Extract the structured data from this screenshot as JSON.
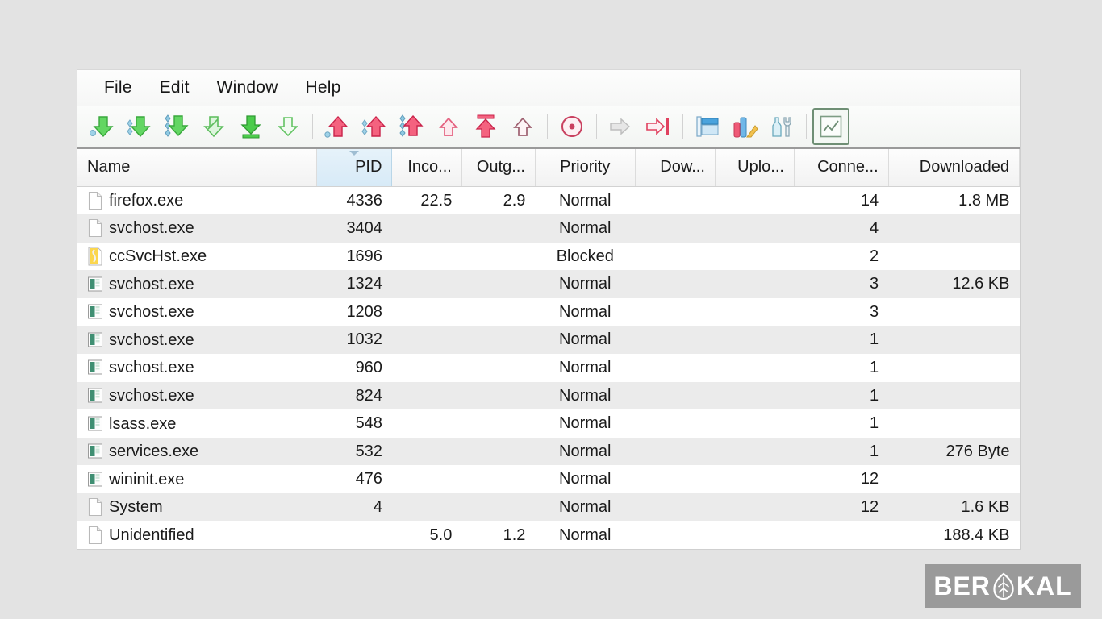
{
  "window": {
    "menu": [
      {
        "label": "File",
        "name": "menu-file"
      },
      {
        "label": "Edit",
        "name": "menu-edit"
      },
      {
        "label": "Window",
        "name": "menu-window"
      },
      {
        "label": "Help",
        "name": "menu-help"
      }
    ],
    "toolbar": [
      {
        "name": "download-start-button",
        "icon": "arrow-down-green-dot",
        "group": 0
      },
      {
        "name": "download-resume-button",
        "icon": "arrow-down-green-links",
        "group": 0
      },
      {
        "name": "download-all-button",
        "icon": "arrow-down-green-double",
        "group": 0
      },
      {
        "name": "download-pause-button",
        "icon": "arrow-down-green-outline",
        "group": 0
      },
      {
        "name": "download-limit-button",
        "icon": "arrow-down-green-bar",
        "group": 0
      },
      {
        "name": "download-stop-button",
        "icon": "arrow-down-green-hollow",
        "group": 0
      },
      {
        "name": "upload-start-button",
        "icon": "arrow-up-red-dot",
        "group": 1
      },
      {
        "name": "upload-resume-button",
        "icon": "arrow-up-red-links",
        "group": 1
      },
      {
        "name": "upload-all-button",
        "icon": "arrow-up-red-double",
        "group": 1
      },
      {
        "name": "upload-pause-button",
        "icon": "arrow-up-red-outline",
        "group": 1
      },
      {
        "name": "upload-limit-button",
        "icon": "arrow-up-red-bar",
        "group": 1
      },
      {
        "name": "upload-stop-button",
        "icon": "arrow-up-red-hollow",
        "group": 1
      },
      {
        "name": "record-button",
        "icon": "record-circle",
        "group": 2
      },
      {
        "name": "forward-traffic-button",
        "icon": "arrow-right-grey",
        "group": 3
      },
      {
        "name": "block-traffic-button",
        "icon": "arrow-right-red-block",
        "group": 3
      },
      {
        "name": "window-layout-button",
        "icon": "window-blue",
        "group": 4
      },
      {
        "name": "statistics-button",
        "icon": "bar-chart-color",
        "group": 4
      },
      {
        "name": "settings-button",
        "icon": "bottle-wrench",
        "group": 4
      },
      {
        "name": "graph-view-button",
        "icon": "graph-framed",
        "group": 5,
        "active": true
      }
    ],
    "table": {
      "columns": [
        {
          "label": "Name",
          "name": "column-name",
          "align": "left",
          "width": "25.4%",
          "sorted": false
        },
        {
          "label": "PID",
          "name": "column-pid",
          "align": "right",
          "width": "8.0%",
          "sorted": true
        },
        {
          "label": "Inco...",
          "name": "column-incoming",
          "align": "right",
          "width": "7.4%",
          "sorted": false
        },
        {
          "label": "Outg...",
          "name": "column-outgoing",
          "align": "right",
          "width": "7.8%",
          "sorted": false
        },
        {
          "label": "Priority",
          "name": "column-priority",
          "align": "center",
          "width": "10.6%",
          "sorted": false
        },
        {
          "label": "Dow...",
          "name": "column-download",
          "align": "right",
          "width": "8.5%",
          "sorted": false
        },
        {
          "label": "Uplo...",
          "name": "column-upload",
          "align": "right",
          "width": "8.4%",
          "sorted": false
        },
        {
          "label": "Conne...",
          "name": "column-connections",
          "align": "right",
          "width": "10.0%",
          "sorted": false
        },
        {
          "label": "Downloaded",
          "name": "column-downloaded",
          "align": "right",
          "width": "13.9%",
          "sorted": false
        }
      ],
      "rows": [
        {
          "icon": "file-blank",
          "name": "firefox.exe",
          "pid": "4336",
          "incoming": "22.5",
          "outgoing": "2.9",
          "priority": "Normal",
          "download": "",
          "upload": "",
          "connections": "14",
          "downloaded": "1.8 MB"
        },
        {
          "icon": "file-blank",
          "name": "svchost.exe",
          "pid": "3404",
          "incoming": "",
          "outgoing": "",
          "priority": "Normal",
          "download": "",
          "upload": "",
          "connections": "4",
          "downloaded": ""
        },
        {
          "icon": "file-yellow",
          "name": "ccSvcHst.exe",
          "pid": "1696",
          "incoming": "",
          "outgoing": "",
          "priority": "Blocked",
          "download": "",
          "upload": "",
          "connections": "2",
          "downloaded": ""
        },
        {
          "icon": "service-green",
          "name": "svchost.exe",
          "pid": "1324",
          "incoming": "",
          "outgoing": "",
          "priority": "Normal",
          "download": "",
          "upload": "",
          "connections": "3",
          "downloaded": "12.6 KB"
        },
        {
          "icon": "service-green",
          "name": "svchost.exe",
          "pid": "1208",
          "incoming": "",
          "outgoing": "",
          "priority": "Normal",
          "download": "",
          "upload": "",
          "connections": "3",
          "downloaded": ""
        },
        {
          "icon": "service-green",
          "name": "svchost.exe",
          "pid": "1032",
          "incoming": "",
          "outgoing": "",
          "priority": "Normal",
          "download": "",
          "upload": "",
          "connections": "1",
          "downloaded": ""
        },
        {
          "icon": "service-green",
          "name": "svchost.exe",
          "pid": "960",
          "incoming": "",
          "outgoing": "",
          "priority": "Normal",
          "download": "",
          "upload": "",
          "connections": "1",
          "downloaded": ""
        },
        {
          "icon": "service-green",
          "name": "svchost.exe",
          "pid": "824",
          "incoming": "",
          "outgoing": "",
          "priority": "Normal",
          "download": "",
          "upload": "",
          "connections": "1",
          "downloaded": ""
        },
        {
          "icon": "service-green",
          "name": "lsass.exe",
          "pid": "548",
          "incoming": "",
          "outgoing": "",
          "priority": "Normal",
          "download": "",
          "upload": "",
          "connections": "1",
          "downloaded": ""
        },
        {
          "icon": "service-green",
          "name": "services.exe",
          "pid": "532",
          "incoming": "",
          "outgoing": "",
          "priority": "Normal",
          "download": "",
          "upload": "",
          "connections": "1",
          "downloaded": "276 Byte"
        },
        {
          "icon": "service-green",
          "name": "wininit.exe",
          "pid": "476",
          "incoming": "",
          "outgoing": "",
          "priority": "Normal",
          "download": "",
          "upload": "",
          "connections": "12",
          "downloaded": ""
        },
        {
          "icon": "file-blank",
          "name": "System",
          "pid": "4",
          "incoming": "",
          "outgoing": "",
          "priority": "Normal",
          "download": "",
          "upload": "",
          "connections": "12",
          "downloaded": "1.6 KB"
        },
        {
          "icon": "file-blank",
          "name": "Unidentified",
          "pid": "",
          "incoming": "5.0",
          "outgoing": "1.2",
          "priority": "Normal",
          "download": "",
          "upload": "",
          "connections": "",
          "downloaded": "188.4 KB"
        }
      ]
    }
  },
  "watermark": {
    "text_left": "BER",
    "text_right": "KAL",
    "icon": "leaf-icon",
    "background": "#9a9a9a",
    "foreground": "#ffffff"
  },
  "colors": {
    "download_arrow": "#4cc24c",
    "upload_arrow": "#ef4a6e",
    "sorted_header": "#ddecf7",
    "row_alt": "#ebebeb",
    "page_background": "#e3e3e3"
  }
}
